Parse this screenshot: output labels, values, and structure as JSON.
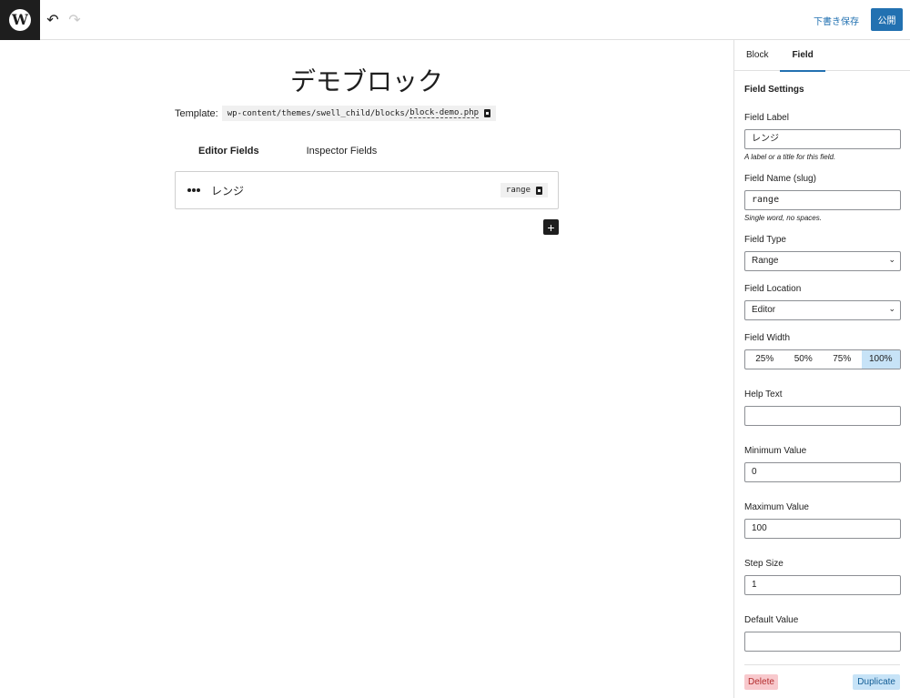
{
  "topbar": {
    "logo_letter": "W",
    "undo_glyph": "↶",
    "redo_glyph": "↷",
    "save_draft_label": "下書き保存",
    "publish_label": "公開"
  },
  "editor": {
    "block_title": "デモブロック",
    "template_label": "Template:",
    "template_path_prefix": "wp-content/themes/swell_child/blocks/",
    "template_path_file": "block-demo.php",
    "tabs": [
      {
        "label": "Editor Fields",
        "active": true
      },
      {
        "label": "Inspector Fields",
        "active": false
      }
    ],
    "field": {
      "label": "レンジ",
      "slug": "range"
    },
    "add_glyph": "+"
  },
  "sidebar": {
    "tabs": [
      {
        "label": "Block",
        "active": false
      },
      {
        "label": "Field",
        "active": true
      }
    ],
    "heading": "Field Settings",
    "field_label": {
      "label": "Field Label",
      "value": "レンジ",
      "help": "A label or a title for this field."
    },
    "field_name": {
      "label": "Field Name (slug)",
      "value": "range",
      "help": "Single word, no spaces."
    },
    "field_type": {
      "label": "Field Type",
      "value": "Range"
    },
    "field_location": {
      "label": "Field Location",
      "value": "Editor"
    },
    "field_width": {
      "label": "Field Width",
      "options": [
        "25%",
        "50%",
        "75%",
        "100%"
      ],
      "selected": "100%"
    },
    "help_text": {
      "label": "Help Text",
      "value": ""
    },
    "minimum_value": {
      "label": "Minimum Value",
      "value": "0"
    },
    "maximum_value": {
      "label": "Maximum Value",
      "value": "100"
    },
    "step_size": {
      "label": "Step Size",
      "value": "1"
    },
    "default_value": {
      "label": "Default Value",
      "value": ""
    },
    "delete_label": "Delete",
    "duplicate_label": "Duplicate",
    "chevron_glyph": "⌄"
  },
  "colors": {
    "accent": "#2271b1",
    "selected_bg": "#c7e3f7",
    "delete_bg": "#f8c9cd",
    "dark": "#1e1e1e"
  },
  "icons": {
    "logo": "wordpress-logo-icon",
    "undo": "undo-icon",
    "redo": "redo-icon",
    "copy": "copy-icon",
    "range_field": "range-dots-icon",
    "add": "plus-icon",
    "select": "chevron-down-icon"
  }
}
